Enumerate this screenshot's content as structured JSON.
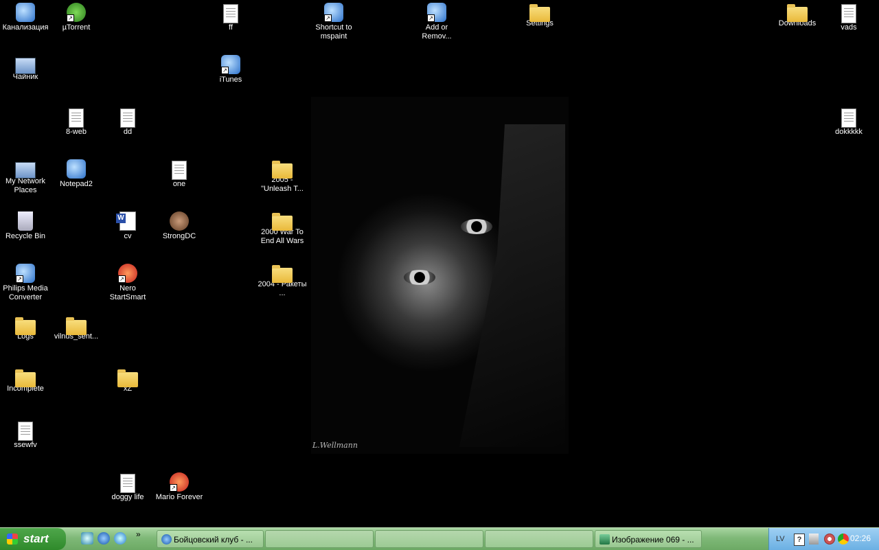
{
  "desktop": {
    "icons": [
      {
        "label": "Канализация",
        "icon": "folder-envelope-icon",
        "kind": "ico-generic",
        "shortcut": false
      },
      {
        "label": "µTorrent",
        "icon": "utorrent-icon",
        "kind": "ico-green",
        "shortcut": true
      },
      {
        "label": "ff",
        "icon": "text-document-icon",
        "kind": "ico-doc",
        "shortcut": false
      },
      {
        "label": "Shortcut to mspaint",
        "icon": "paint-brushes-icon",
        "kind": "ico-generic",
        "shortcut": true
      },
      {
        "label": "Add or Remov...",
        "icon": "add-remove-programs-icon",
        "kind": "ico-generic",
        "shortcut": true
      },
      {
        "label": "Settings",
        "icon": "folder-icon",
        "kind": "ico-folder",
        "shortcut": false
      },
      {
        "label": "Downloads",
        "icon": "folder-icon",
        "kind": "ico-folder",
        "shortcut": false
      },
      {
        "label": "vads",
        "icon": "text-document-icon",
        "kind": "ico-doc",
        "shortcut": false
      },
      {
        "label": "Чайник",
        "icon": "computer-icon",
        "kind": "ico-pc",
        "shortcut": false
      },
      {
        "label": "iTunes",
        "icon": "itunes-icon",
        "kind": "ico-generic",
        "shortcut": true
      },
      {
        "label": "8-web",
        "icon": "web-archive-icon",
        "kind": "ico-doc",
        "shortcut": false
      },
      {
        "label": "dd",
        "icon": "text-document-icon",
        "kind": "ico-doc",
        "shortcut": false
      },
      {
        "label": "dokkkkk",
        "icon": "text-document-icon",
        "kind": "ico-doc",
        "shortcut": false
      },
      {
        "label": "My Network Places",
        "icon": "network-places-icon",
        "kind": "ico-pc",
        "shortcut": false
      },
      {
        "label": "Notepad2",
        "icon": "notepad-icon",
        "kind": "ico-generic",
        "shortcut": false
      },
      {
        "label": "one",
        "icon": "text-document-icon",
        "kind": "ico-doc",
        "shortcut": false
      },
      {
        "label": "2005 - \"Unleash T...",
        "icon": "folder-icon",
        "kind": "ico-folder",
        "shortcut": false
      },
      {
        "label": "Recycle Bin",
        "icon": "recycle-bin-icon",
        "kind": "ico-bin",
        "shortcut": false
      },
      {
        "label": "cv",
        "icon": "word-document-icon",
        "kind": "ico-word",
        "shortcut": false
      },
      {
        "label": "StrongDC",
        "icon": "strongdc-icon",
        "kind": "ico-brown",
        "shortcut": false
      },
      {
        "label": "2000 War To End All Wars",
        "icon": "folder-icon",
        "kind": "ico-folder",
        "shortcut": false
      },
      {
        "label": "Philips Media Converter",
        "icon": "media-converter-icon",
        "kind": "ico-generic",
        "shortcut": true
      },
      {
        "label": "Nero StartSmart",
        "icon": "nero-icon",
        "kind": "ico-red",
        "shortcut": true
      },
      {
        "label": "2004 - Ракеты ...",
        "icon": "folder-icon",
        "kind": "ico-folder",
        "shortcut": false
      },
      {
        "label": "Logs",
        "icon": "folder-icon",
        "kind": "ico-folder",
        "shortcut": false
      },
      {
        "label": "vilnus_sent...",
        "icon": "folder-icon",
        "kind": "ico-folder",
        "shortcut": false
      },
      {
        "label": "Incomplete",
        "icon": "folder-icon",
        "kind": "ico-folder",
        "shortcut": false
      },
      {
        "label": "xZ",
        "icon": "folder-icon",
        "kind": "ico-folder",
        "shortcut": false
      },
      {
        "label": "ssewfv",
        "icon": "text-document-icon",
        "kind": "ico-doc",
        "shortcut": false
      },
      {
        "label": "doggy life",
        "icon": "text-document-icon",
        "kind": "ico-doc",
        "shortcut": false
      },
      {
        "label": "Mario Forever",
        "icon": "mario-icon",
        "kind": "ico-red",
        "shortcut": true
      }
    ],
    "wallpaper_signature": "L.Wellmann"
  },
  "taskbar": {
    "start_label": "start",
    "quick_launch": [
      "show-desktop-icon",
      "internet-explorer-icon",
      "media-player-icon"
    ],
    "overflow_label": "»",
    "tasks": [
      {
        "label": "Бойцовский клуб - ...",
        "icon": "internet-explorer-icon"
      },
      {
        "label": "",
        "icon": ""
      },
      {
        "label": "",
        "icon": ""
      },
      {
        "label": "",
        "icon": ""
      },
      {
        "label": "Изображение 069 - ...",
        "icon": "image-viewer-icon"
      }
    ],
    "tray": {
      "language": "LV",
      "help": "?",
      "clock": "02:26"
    }
  }
}
